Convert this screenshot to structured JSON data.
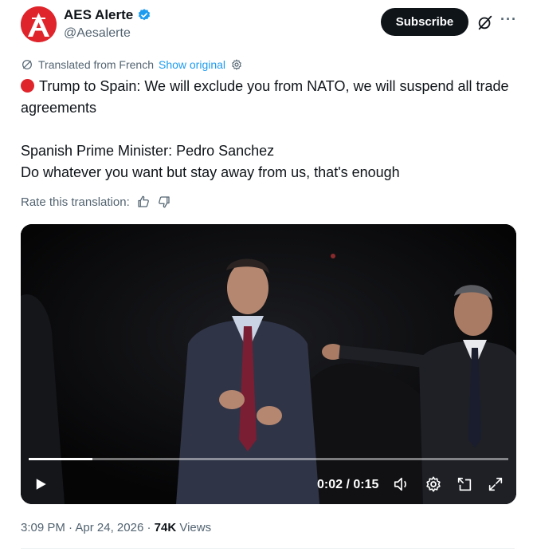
{
  "author": {
    "name": "AES Alerte",
    "handle": "@Aesalerte",
    "avatar_icon": "aes-logo-icon",
    "verified_icon": "verified-badge-icon",
    "brand_color": "#e0242b"
  },
  "header": {
    "subscribe_label": "Subscribe",
    "grok_icon": "grok-icon",
    "more_label": "···"
  },
  "translation": {
    "translated_from": "Translated from French",
    "show_original": "Show original",
    "rate_label": "Rate this translation:"
  },
  "tweet": {
    "line1": "Trump to Spain: We will exclude you from NATO, we will suspend all trade agreements",
    "line2": "Spanish Prime Minister: Pedro Sanchez",
    "line3": "Do whatever you want but stay away from us, that's enough"
  },
  "video": {
    "current_time": "0:02",
    "duration": "0:15",
    "time_display": "0:02 / 0:15",
    "progress": 0.133
  },
  "meta": {
    "time": "3:09 PM",
    "date": "Apr 24, 2026",
    "views_count": "74K",
    "views_label": "Views",
    "separator": "·"
  },
  "colors": {
    "link": "#1d9bf0",
    "secondary_text": "#536471",
    "primary_text": "#0f1419"
  }
}
